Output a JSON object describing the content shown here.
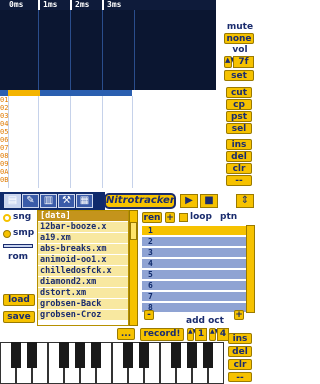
{
  "pattern": {
    "columns": [
      "0ms",
      "1ms",
      "2ms",
      "3ms"
    ],
    "rows": [
      "00",
      "01",
      "02",
      "03",
      "04",
      "05",
      "06",
      "07",
      "08",
      "09",
      "0A",
      "0B"
    ]
  },
  "right": {
    "mute_label": "mute",
    "none_label": "none",
    "vol_label": "vol",
    "vol_value": "7f",
    "set_label": "set",
    "cut_label": "cut",
    "cp_label": "cp",
    "pst_label": "pst",
    "sel_label": "sel",
    "ins_label": "ins",
    "del_label": "del",
    "clr_label": "clr",
    "dash_label": "--"
  },
  "tabs": {
    "icons": [
      "disk-icon",
      "pencil-icon",
      "piano-icon",
      "wrench-icon",
      "keyboard-icon"
    ],
    "logo": "Nitrotracker",
    "play_symbol": "▶",
    "stop_symbol": "■"
  },
  "mode": {
    "sng_label": "sng",
    "smp_label": "smp",
    "rom_label": "rom",
    "load_label": "load",
    "save_label": "save",
    "dots_label": "..."
  },
  "files": [
    "[data]",
    "12bar-booze.x",
    "a19.xm",
    "abs-breaks.xm",
    "animoid-oo1.x",
    "chilledosfck.x",
    "diamond2.xm",
    "dstort.xm",
    "grobsen-Back",
    "grobsen-Croz"
  ],
  "sequence": {
    "ren_label": "ren",
    "plus_label": "+",
    "loop_label": "loop",
    "ptn_label": "ptn",
    "items": [
      "1",
      "2",
      "3",
      "4",
      "5",
      "6",
      "7",
      "8"
    ],
    "minus_label": "-",
    "add_label": "+"
  },
  "octave": {
    "label": "add oct",
    "record_label": "record!",
    "add_value": "1",
    "oct_value": "4"
  },
  "bottom_buttons": {
    "ins": "ins",
    "del": "del",
    "clr": "clr",
    "dash": "--"
  }
}
